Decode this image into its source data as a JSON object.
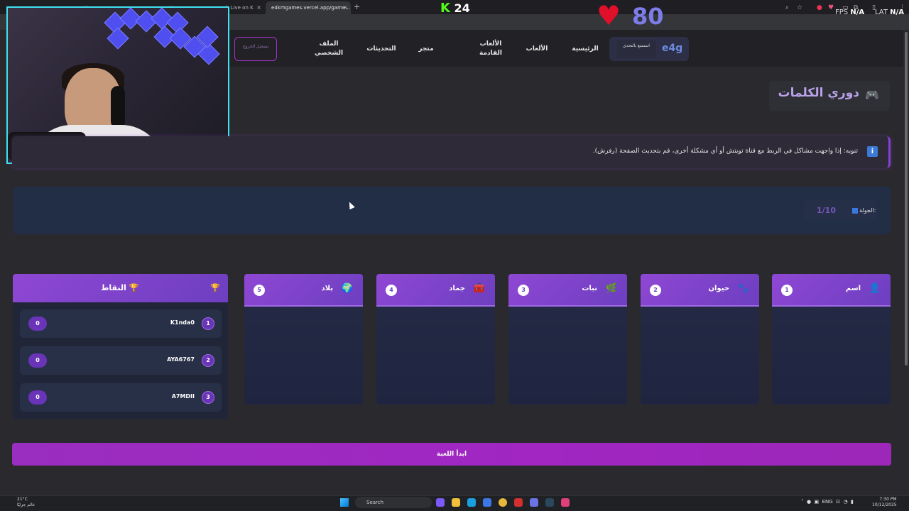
{
  "browser": {
    "tabs": [
      {
        "label": "",
        "active": false
      },
      {
        "label": "",
        "active": false
      },
      {
        "label": "h Live on K",
        "active": false
      },
      {
        "label": "e4kmgames.vercel.app/game...",
        "active": true
      }
    ],
    "tab_close": "×",
    "new_tab": "+"
  },
  "overlay": {
    "kick_letter": "K",
    "kick_count": "24",
    "heart_glyph": "♥",
    "heart_rate": "80",
    "fps_label": "FPS",
    "fps_value": "N/A",
    "lat_label": "LAT",
    "lat_value": "N/A"
  },
  "header": {
    "logout_label": "تسجيل الخروج",
    "nav": {
      "profile": "الملف الشخصي",
      "updates": "التحديثات",
      "store": "متجر",
      "upcoming": "الألعاب القادمة",
      "games": "الألعاب",
      "home": "الرئيسية"
    },
    "challenge_label": "استمتع بالتحدي",
    "logo": "e4g"
  },
  "page": {
    "title": "دوري الكلمات",
    "title_icon": "🎮",
    "notice": "تنويه: إذا واجهت مشاكل في الربط مع قناة تويتش أو أي مشكلة أخرى، قم بتحديث الصفحة (رفرش).",
    "info_icon": "i",
    "round_label": "الجولة:",
    "round_value": "1/10",
    "start_button": "ابدأ اللعبة"
  },
  "categories": [
    {
      "num": "1",
      "label": "اسم",
      "icon": "👤"
    },
    {
      "num": "2",
      "label": "حيوان",
      "icon": "🐾"
    },
    {
      "num": "3",
      "label": "نبات",
      "icon": "🌿"
    },
    {
      "num": "4",
      "label": "جماد",
      "icon": "🧰"
    },
    {
      "num": "5",
      "label": "بلاد",
      "icon": "🌍"
    }
  ],
  "scores": {
    "title": "النقاط",
    "icon": "🏆",
    "players": [
      {
        "rank": "1",
        "name": "K1nda0",
        "points": "0"
      },
      {
        "rank": "2",
        "name": "AYA6767",
        "points": "0"
      },
      {
        "rank": "3",
        "name": "A7MDII",
        "points": "0"
      }
    ]
  },
  "taskbar": {
    "weather_temp": "21°C",
    "weather_text": "غالم جزئيًا",
    "search_label": "Search",
    "lang": "ENG",
    "time": "7:30 PM",
    "date": "10/12/2025"
  }
}
